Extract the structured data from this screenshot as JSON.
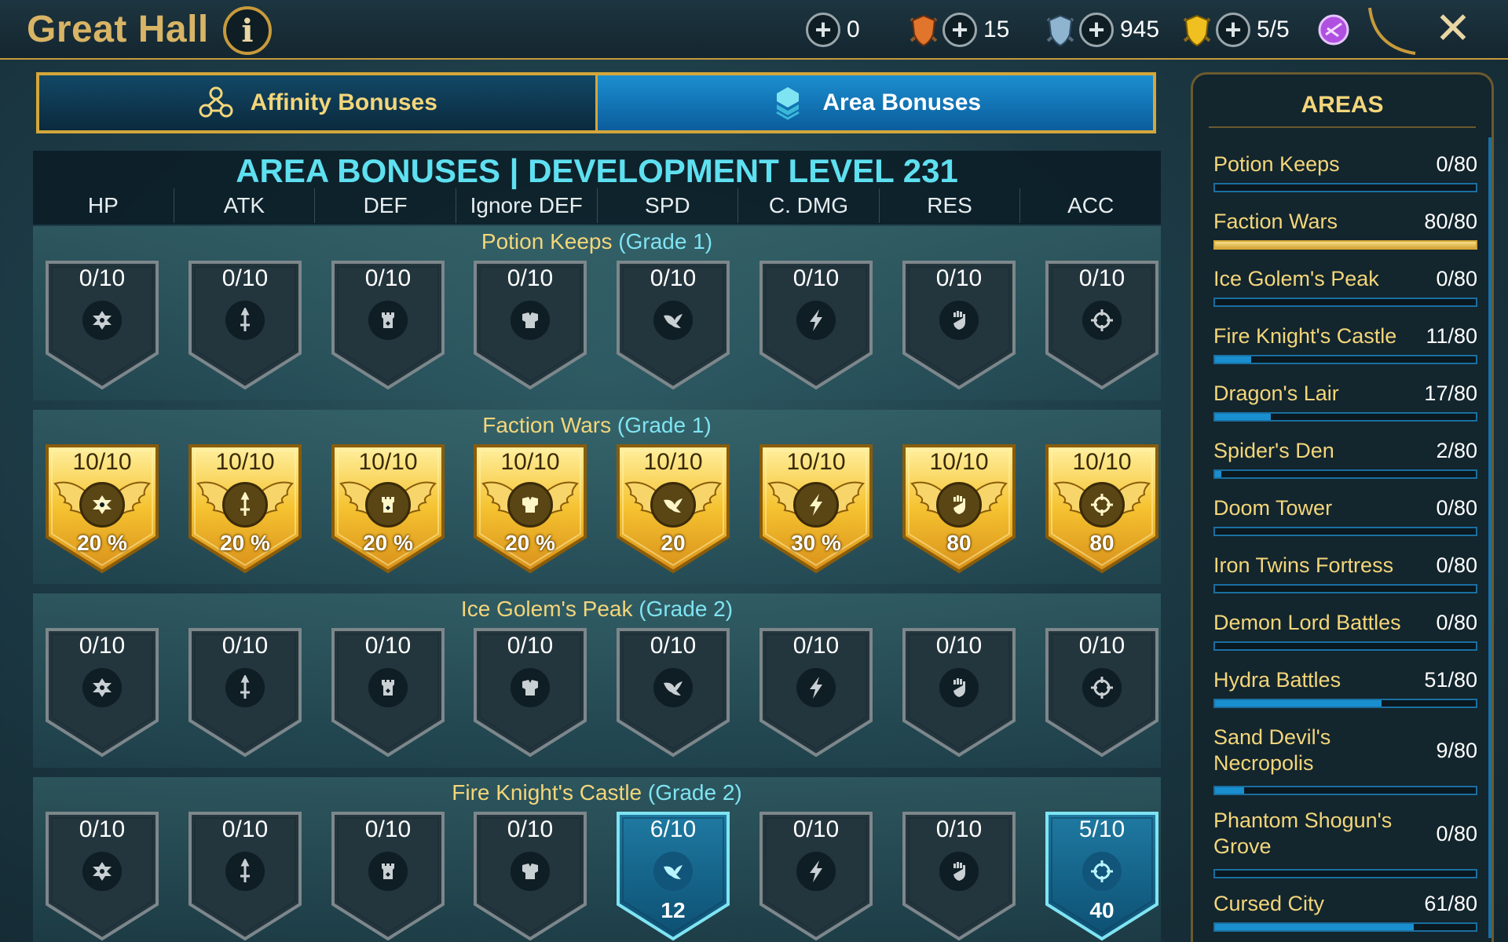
{
  "header": {
    "title": "Great Hall",
    "info_icon": "info-icon",
    "resources": [
      {
        "value": "0",
        "icon": "orange-shield-icon",
        "color": "#e0752b"
      },
      {
        "value": "15",
        "icon": "blue-shield-icon",
        "color": "#8fb4d0"
      },
      {
        "value": "945",
        "icon": "gold-shield-icon",
        "color": "#f0c020"
      },
      {
        "value": "5/5",
        "icon": "purple-gem-icon",
        "color": "#b050e0"
      }
    ],
    "close_icon": "close-icon"
  },
  "tabs": [
    {
      "label": "Affinity Bonuses",
      "icon": "affinity-icon",
      "active": false
    },
    {
      "label": "Area Bonuses",
      "icon": "area-icon",
      "active": true
    }
  ],
  "main": {
    "title": "AREA BONUSES | DEVELOPMENT LEVEL 231",
    "stats": [
      "HP",
      "ATK",
      "DEF",
      "Ignore DEF",
      "SPD",
      "C. DMG",
      "RES",
      "ACC"
    ],
    "stat_icons": [
      "hp-icon",
      "atk-icon",
      "def-icon",
      "ignore-def-icon",
      "spd-icon",
      "cdmg-icon",
      "res-icon",
      "acc-icon"
    ],
    "sections": [
      {
        "name": "Potion Keeps",
        "grade": "(Grade 1)",
        "badges": [
          {
            "progress": "0/10",
            "bonus": "",
            "state": "locked"
          },
          {
            "progress": "0/10",
            "bonus": "",
            "state": "locked"
          },
          {
            "progress": "0/10",
            "bonus": "",
            "state": "locked"
          },
          {
            "progress": "0/10",
            "bonus": "",
            "state": "locked"
          },
          {
            "progress": "0/10",
            "bonus": "",
            "state": "locked"
          },
          {
            "progress": "0/10",
            "bonus": "",
            "state": "locked"
          },
          {
            "progress": "0/10",
            "bonus": "",
            "state": "locked"
          },
          {
            "progress": "0/10",
            "bonus": "",
            "state": "locked"
          }
        ]
      },
      {
        "name": "Faction Wars",
        "grade": "(Grade 1)",
        "badges": [
          {
            "progress": "10/10",
            "bonus": "20 %",
            "state": "gold"
          },
          {
            "progress": "10/10",
            "bonus": "20 %",
            "state": "gold"
          },
          {
            "progress": "10/10",
            "bonus": "20 %",
            "state": "gold"
          },
          {
            "progress": "10/10",
            "bonus": "20 %",
            "state": "gold"
          },
          {
            "progress": "10/10",
            "bonus": "20",
            "state": "gold"
          },
          {
            "progress": "10/10",
            "bonus": "30 %",
            "state": "gold"
          },
          {
            "progress": "10/10",
            "bonus": "80",
            "state": "gold"
          },
          {
            "progress": "10/10",
            "bonus": "80",
            "state": "gold"
          }
        ]
      },
      {
        "name": "Ice Golem's Peak",
        "grade": "(Grade 2)",
        "badges": [
          {
            "progress": "0/10",
            "bonus": "",
            "state": "locked"
          },
          {
            "progress": "0/10",
            "bonus": "",
            "state": "locked"
          },
          {
            "progress": "0/10",
            "bonus": "",
            "state": "locked"
          },
          {
            "progress": "0/10",
            "bonus": "",
            "state": "locked"
          },
          {
            "progress": "0/10",
            "bonus": "",
            "state": "locked"
          },
          {
            "progress": "0/10",
            "bonus": "",
            "state": "locked"
          },
          {
            "progress": "0/10",
            "bonus": "",
            "state": "locked"
          },
          {
            "progress": "0/10",
            "bonus": "",
            "state": "locked"
          }
        ]
      },
      {
        "name": "Fire Knight's Castle",
        "grade": "(Grade 2)",
        "badges": [
          {
            "progress": "0/10",
            "bonus": "",
            "state": "locked"
          },
          {
            "progress": "0/10",
            "bonus": "",
            "state": "locked"
          },
          {
            "progress": "0/10",
            "bonus": "",
            "state": "locked"
          },
          {
            "progress": "0/10",
            "bonus": "",
            "state": "locked"
          },
          {
            "progress": "6/10",
            "bonus": "12",
            "state": "teal"
          },
          {
            "progress": "0/10",
            "bonus": "",
            "state": "locked"
          },
          {
            "progress": "0/10",
            "bonus": "",
            "state": "locked"
          },
          {
            "progress": "5/10",
            "bonus": "40",
            "state": "teal"
          }
        ]
      }
    ]
  },
  "sidebar": {
    "title": "AREAS",
    "areas": [
      {
        "name": "Potion Keeps",
        "count": "0/80",
        "fill": 0
      },
      {
        "name": "Faction Wars",
        "count": "80/80",
        "fill": 1
      },
      {
        "name": "Ice Golem's Peak",
        "count": "0/80",
        "fill": 0
      },
      {
        "name": "Fire Knight's Castle",
        "count": "11/80",
        "fill": 0.1375
      },
      {
        "name": "Dragon's Lair",
        "count": "17/80",
        "fill": 0.2125
      },
      {
        "name": "Spider's Den",
        "count": "2/80",
        "fill": 0.025
      },
      {
        "name": "Doom Tower",
        "count": "0/80",
        "fill": 0
      },
      {
        "name": "Iron Twins Fortress",
        "count": "0/80",
        "fill": 0
      },
      {
        "name": "Demon Lord Battles",
        "count": "0/80",
        "fill": 0
      },
      {
        "name": "Hydra Battles",
        "count": "51/80",
        "fill": 0.6375
      },
      {
        "name": "Sand Devil's Necropolis",
        "count": "9/80",
        "fill": 0.1125
      },
      {
        "name": "Phantom Shogun's Grove",
        "count": "0/80",
        "fill": 0
      },
      {
        "name": "Cursed City",
        "count": "61/80",
        "fill": 0.7625
      }
    ]
  }
}
